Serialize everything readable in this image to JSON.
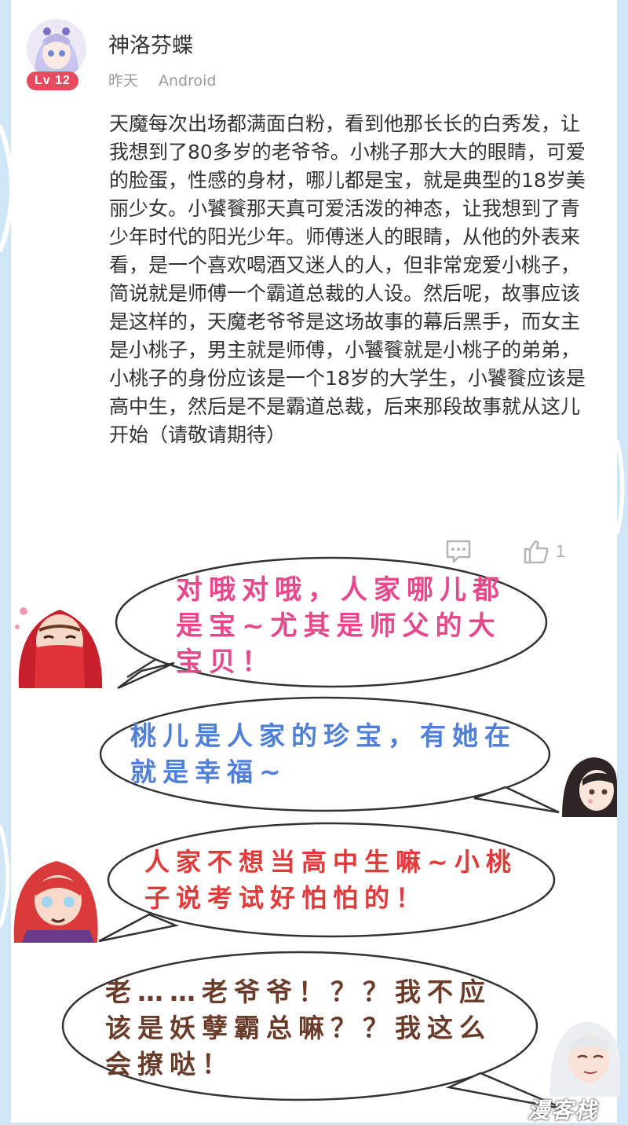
{
  "post": {
    "username": "神洛芬蝶",
    "level": "Lv 12",
    "time": "昨天",
    "device": "Android",
    "content": "天魔每次出场都满面白粉，看到他那长长的白秀发，让我想到了80多岁的老爷爷。小桃子那大大的眼睛，可爱的脸蛋，性感的身材，哪儿都是宝，就是典型的18岁美丽少女。小饕餮那天真可爱活泼的神态，让我想到了青少年时代的阳光少年。师傅迷人的眼睛，从他的外表来看，是一个喜欢喝酒又迷人的人，但非常宠爱小桃子，简说就是师傅一个霸道总裁的人设。然后呢，故事应该是这样的，天魔老爷爷是这场故事的幕后黑手，而女主是小桃子，男主就是师傅，小饕餮就是小桃子的弟弟，小桃子的身份应该是一个18岁的大学生，小饕餮应该是高中生，然后是不是霸道总裁，后来那段故事就从这儿开始（请敬请期待）",
    "like_count": "1",
    "comment_icon": "comment-icon",
    "like_icon": "thumbs-up-icon"
  },
  "bubbles": [
    {
      "text": "对哦对哦，人家哪儿都是宝~尤其是师父的大宝贝！",
      "color": "#e8478c",
      "character": "red-veiled-bride"
    },
    {
      "text": "桃儿是人家的珍宝，有她在就是幸福~",
      "color": "#4f7fd6",
      "character": "dark-haired-girl"
    },
    {
      "text": "人家不想当高中生嘛~小桃子说考试好怕怕的！",
      "color": "#e23a3a",
      "character": "red-haired-boy"
    },
    {
      "text": "老……老爷爷！？？我不应该是妖孽霸总嘛？？我这么会撩哒！",
      "color": "#6b3b2a",
      "character": "white-haired-man"
    }
  ],
  "watermark": "漫客栈",
  "colors": {
    "page_bg": "#cfe6f7",
    "card_bg": "#ffffff",
    "level_badge": "#e84a5f",
    "text": "#333333",
    "meta": "#9a9a9a"
  }
}
